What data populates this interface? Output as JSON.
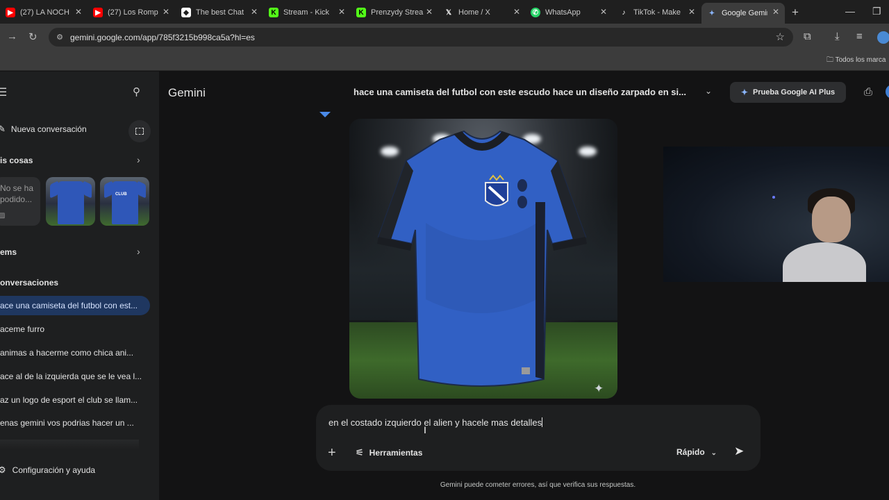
{
  "tabs": [
    {
      "label": "(27) LA NOCH",
      "icon": "youtube-icon",
      "color": "#ff0000"
    },
    {
      "label": "(27) Los Romp",
      "icon": "youtube-icon",
      "color": "#ff0000"
    },
    {
      "label": "The best Chat",
      "icon": "chat-icon",
      "color": "#ffffff"
    },
    {
      "label": "Stream - Kick",
      "icon": "kick-icon",
      "color": "#53fc18"
    },
    {
      "label": "Prenzydy Strea",
      "icon": "kick-icon",
      "color": "#53fc18"
    },
    {
      "label": "Home / X",
      "icon": "x-icon",
      "color": "#ffffff"
    },
    {
      "label": "WhatsApp",
      "icon": "whatsapp-icon",
      "color": "#25d366"
    },
    {
      "label": "TikTok - Make",
      "icon": "tiktok-icon",
      "color": "#ffffff"
    },
    {
      "label": "Google Gemin",
      "icon": "gemini-icon",
      "color": "#8ab4f8"
    }
  ],
  "address": {
    "url": "gemini.google.com/app/785f3215b998ca5a?hl=es"
  },
  "bookmarks": {
    "folder": "Todos los marca"
  },
  "sidebar": {
    "new_chat": "Nueva conversación",
    "my_stuff": "is cosas",
    "placeholder": "No se ha podido...",
    "gems": "ems",
    "conversations_header": "onversaciones",
    "items": [
      "ace una camiseta del futbol con est...",
      "aceme furro",
      "animas a hacerme como chica ani...",
      "ace al de la izquierda que se le vea l...",
      "az un logo de esport el club se llam...",
      "enas gemini vos podrias hacer un ..."
    ],
    "settings": "Configuración y ayuda"
  },
  "main": {
    "brand": "Gemini",
    "conversation_title": "hace una camiseta del futbol con este escudo hace un diseño zarpado en si...",
    "upgrade_button": "Prueba Google AI Plus"
  },
  "input": {
    "prompt_text": "en el costado izquierdo el alien y hacele mas detalles",
    "tools_label": "Herramientas",
    "mode_label": "Rápido"
  },
  "disclaimer": "Gemini puede cometer errores, así que verifica sus respuestas.",
  "colors": {
    "accent": "#8ab4f8",
    "active_item": "#1f3760",
    "jersey_blue": "#2f57b8"
  }
}
